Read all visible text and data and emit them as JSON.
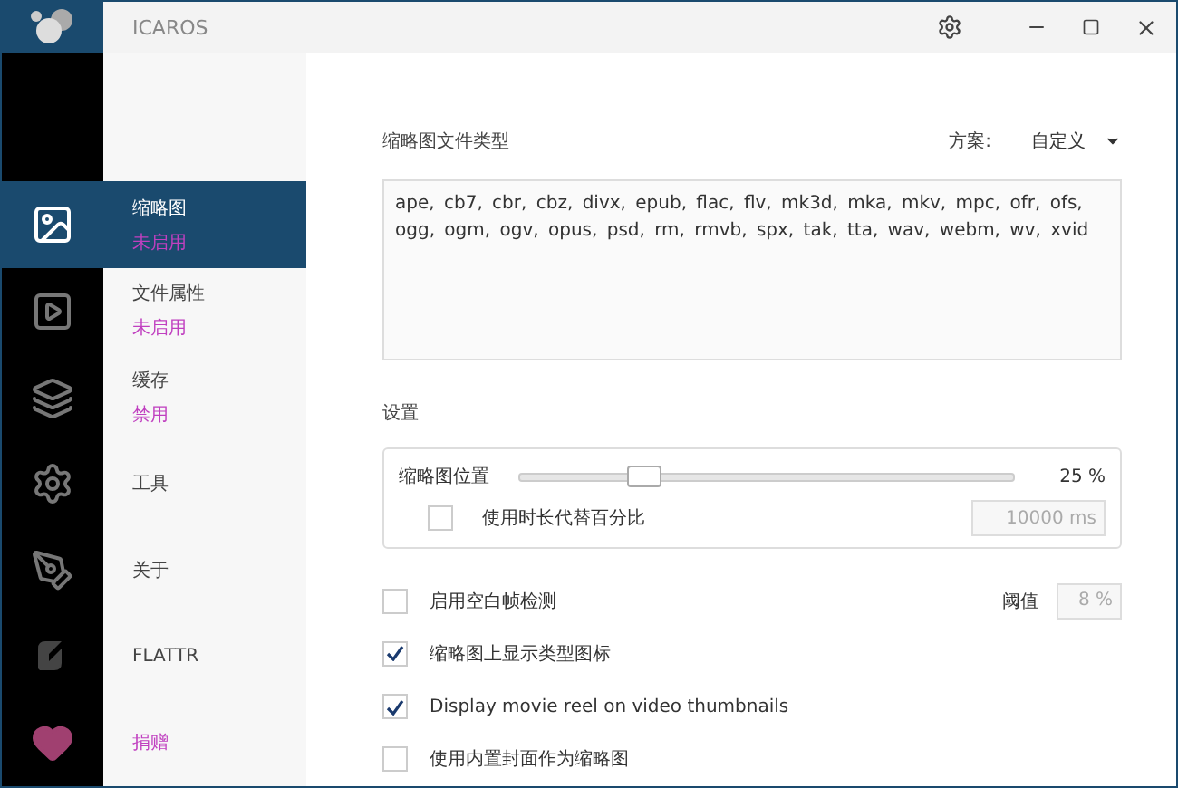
{
  "window": {
    "title": "ICAROS"
  },
  "nav": [
    {
      "kind": "image",
      "label": "缩略图",
      "status": "未启用",
      "selected": true
    },
    {
      "kind": "video",
      "label": "文件属性",
      "status": "未启用",
      "selected": false
    },
    {
      "kind": "cache",
      "label": "缓存",
      "status": "禁用",
      "selected": false
    },
    {
      "kind": "tools",
      "label": "工具",
      "selected": false
    },
    {
      "kind": "about",
      "label": "关于",
      "selected": false
    },
    {
      "kind": "flattr",
      "label": "FLATTR",
      "selected": false
    },
    {
      "kind": "donate",
      "label": "捐赠",
      "selected": false
    }
  ],
  "file_types": {
    "title": "缩略图文件类型",
    "scheme_label": "方案:",
    "scheme_value": "自定义",
    "value": "ape, cb7, cbr, cbz, divx, epub, flac, flv, mk3d, mka, mkv, mpc, ofr, ofs, ogg, ogm, ogv, opus, psd, rm, rmvb, spx, tak, tta, wav, webm, wv, xvid"
  },
  "settings": {
    "title": "设置",
    "position_label": "缩略图位置",
    "level": 0.25,
    "reading": "25 %",
    "use_duration": {
      "label": "使用时长代替百分比",
      "checked": false,
      "value": "10000 ms"
    }
  },
  "options": [
    {
      "label": "启用空白帧检测",
      "checked": false,
      "extra_label": "阈值",
      "extra_value": "8 %"
    },
    {
      "label": "缩略图上显示类型图标",
      "checked": true
    },
    {
      "label": "Display movie reel on video thumbnails",
      "checked": true
    },
    {
      "label": "使用内置封面作为缩略图",
      "checked": false
    }
  ]
}
